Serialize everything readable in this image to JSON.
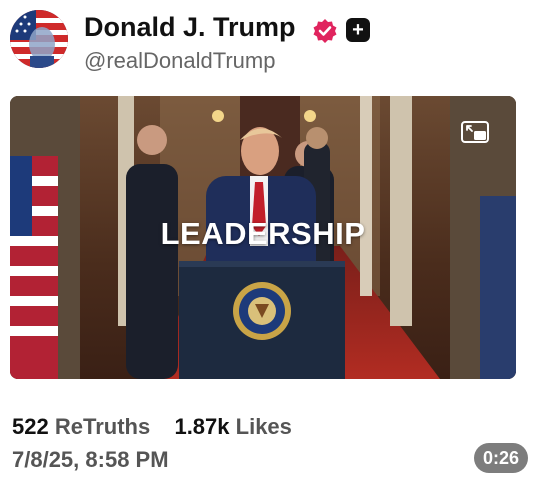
{
  "profile": {
    "display_name": "Donald J. Trump",
    "handle": "@realDonaldTrump",
    "verified_color": "#e0245e",
    "avatar_icon": "avatar-flag-portrait-icon"
  },
  "media": {
    "caption": "LEADERSHIP",
    "seal_text": "PRESIDENT OF THE UNITED STATES",
    "pip_icon": "picture-in-picture-icon",
    "duration": "0:26"
  },
  "stats": {
    "retruths_count": "522",
    "retruths_label": "ReTruths",
    "likes_count": "1.87k",
    "likes_label": "Likes"
  },
  "post": {
    "timestamp": "7/8/25, 8:58 PM"
  },
  "colors": {
    "text": "#111111",
    "muted": "#555555",
    "duration_pill": "#7d7d7d"
  }
}
